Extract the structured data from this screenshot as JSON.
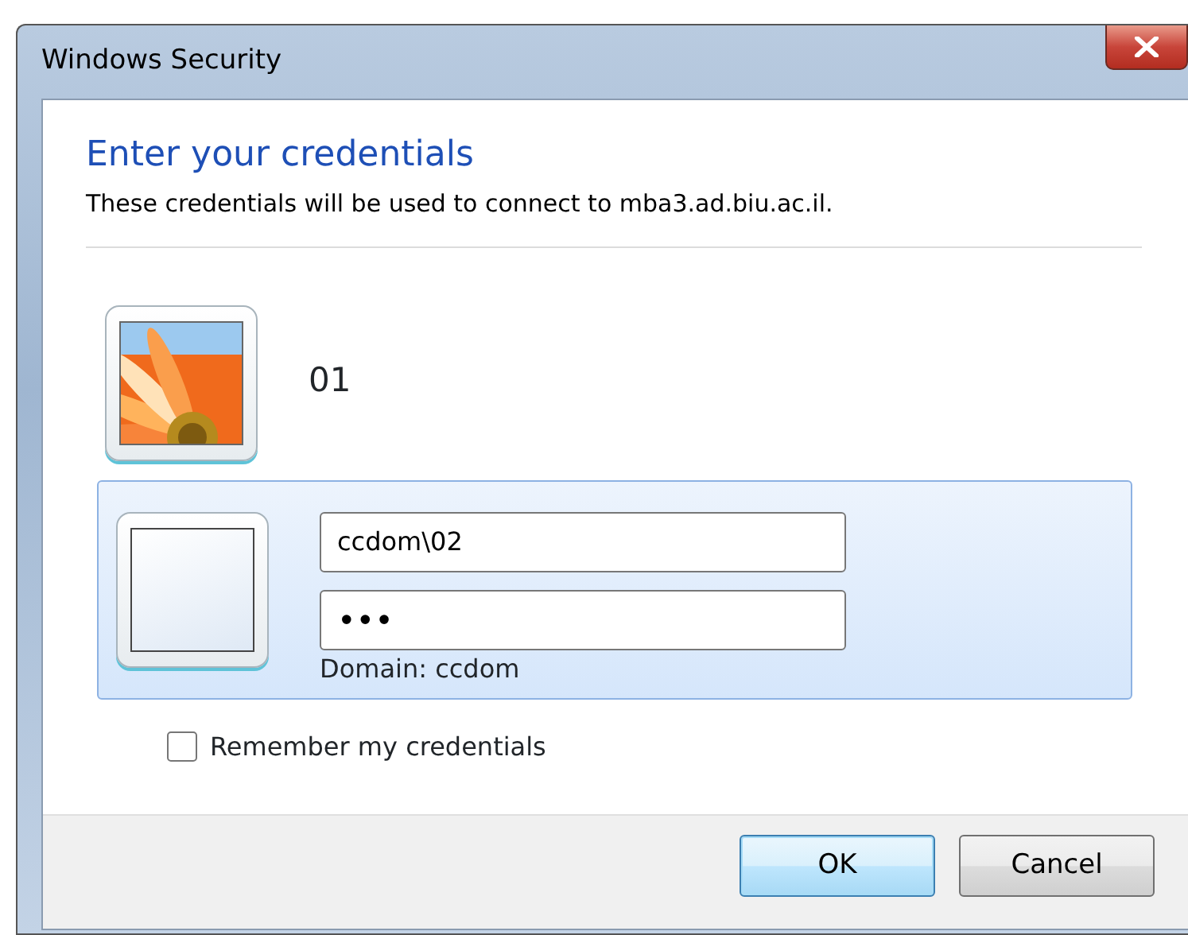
{
  "window": {
    "title": "Windows Security"
  },
  "heading": "Enter your credentials",
  "description": "These credentials will be used to connect to mba3.ad.biu.ac.il.",
  "users": [
    {
      "kind": "picture",
      "name": "01",
      "selected": false
    },
    {
      "kind": "blank",
      "selected": true,
      "username": "ccdom\\02",
      "password": "•••",
      "domain": "Domain: ccdom"
    }
  ],
  "remember": {
    "label": "Remember my credentials",
    "checked": false
  },
  "buttons": [
    {
      "label": "OK",
      "default": true
    },
    {
      "label": "Cancel",
      "default": false
    }
  ]
}
